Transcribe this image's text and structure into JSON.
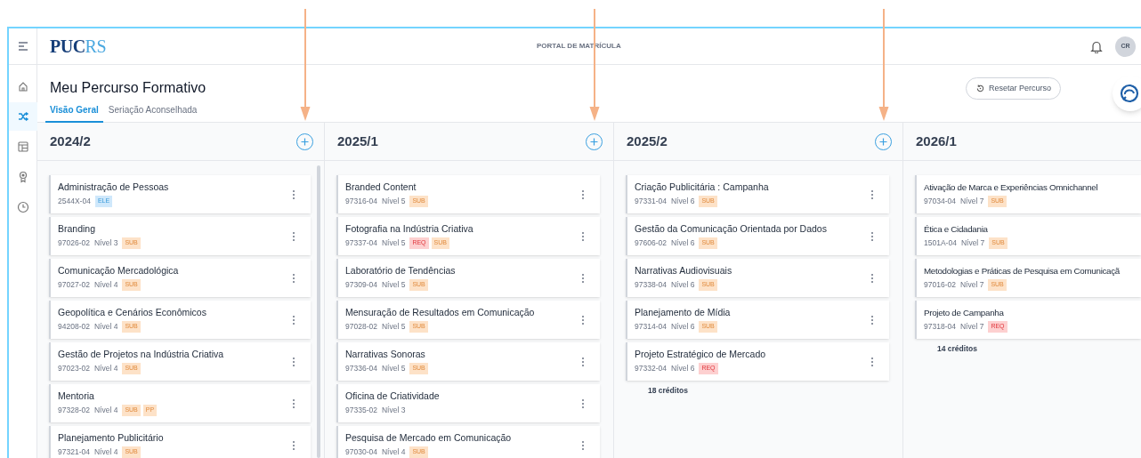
{
  "sidebar": {
    "items": [
      {
        "selected": false
      },
      {
        "selected": true
      },
      {
        "selected": false
      },
      {
        "selected": false
      },
      {
        "selected": false
      }
    ]
  },
  "header": {
    "logo": [
      "PUC",
      "RS"
    ],
    "portal": "PORTAL DE MATRÍCULA",
    "avatar": "CR"
  },
  "page": {
    "title": "Meu Percurso Formativo",
    "reset_button": "Resetar Percurso"
  },
  "tabs": [
    {
      "label": "Visão Geral",
      "selected": true
    },
    {
      "label": "Seriação Aconselhada",
      "selected": false
    }
  ],
  "columns": [
    {
      "term": "2024/2",
      "add_button": true,
      "arrow_marked": true,
      "scrollbar": true,
      "courses": [
        {
          "name": "Administração de Pessoas",
          "code": "2544X-04",
          "tags": [
            {
              "label": "ELE",
              "kind": "ele"
            }
          ]
        },
        {
          "name": "Branding",
          "code": "97026-02",
          "level": "Nível 3",
          "tags": [
            {
              "label": "SUB",
              "kind": "sub"
            }
          ]
        },
        {
          "name": "Comunicação Mercadológica",
          "code": "97027-02",
          "level": "Nível 4",
          "tags": [
            {
              "label": "SUB",
              "kind": "sub"
            }
          ]
        },
        {
          "name": "Geopolítica e Cenários Econômicos",
          "code": "94208-02",
          "level": "Nível 4",
          "tags": [
            {
              "label": "SUB",
              "kind": "sub"
            }
          ]
        },
        {
          "name": "Gestão de Projetos na Indústria Criativa",
          "code": "97023-02",
          "level": "Nível 4",
          "tags": [
            {
              "label": "SUB",
              "kind": "sub"
            }
          ]
        },
        {
          "name": "Mentoria",
          "code": "97328-02",
          "level": "Nível 4",
          "tags": [
            {
              "label": "SUB",
              "kind": "sub"
            },
            {
              "label": "PP",
              "kind": "sub"
            }
          ]
        },
        {
          "name": "Planejamento Publicitário",
          "code": "97321-04",
          "level": "Nível 4",
          "tags": [
            {
              "label": "SUB",
              "kind": "sub"
            }
          ]
        }
      ]
    },
    {
      "term": "2025/1",
      "add_button": true,
      "arrow_marked": true,
      "courses": [
        {
          "name": "Branded Content",
          "code": "97316-04",
          "level": "Nível 5",
          "tags": [
            {
              "label": "SUB",
              "kind": "sub"
            }
          ]
        },
        {
          "name": "Fotografia na Indústria Criativa",
          "code": "97337-04",
          "level": "Nível 5",
          "tags": [
            {
              "label": "REQ",
              "kind": "req"
            },
            {
              "label": "SUB",
              "kind": "sub"
            }
          ]
        },
        {
          "name": "Laboratório de Tendências",
          "code": "97309-04",
          "level": "Nível 5",
          "tags": [
            {
              "label": "SUB",
              "kind": "sub"
            }
          ]
        },
        {
          "name": "Mensuração de Resultados em Comunicação",
          "code": "97028-02",
          "level": "Nível 5",
          "tags": [
            {
              "label": "SUB",
              "kind": "sub"
            }
          ]
        },
        {
          "name": "Narrativas Sonoras",
          "code": "97336-04",
          "level": "Nível 5",
          "tags": [
            {
              "label": "SUB",
              "kind": "sub"
            }
          ]
        },
        {
          "name": "Oficina de Criatividade",
          "code": "97335-02",
          "level": "Nível 3"
        },
        {
          "name": "Pesquisa de Mercado em Comunicação",
          "code": "97030-04",
          "level": "Nível 4",
          "tags": [
            {
              "label": "SUB",
              "kind": "sub"
            }
          ]
        }
      ]
    },
    {
      "term": "2025/2",
      "add_button": true,
      "arrow_marked": true,
      "credits": "18 créditos",
      "courses": [
        {
          "name": "Criação Publicitária : Campanha",
          "code": "97331-04",
          "level": "Nível 6",
          "tags": [
            {
              "label": "SUB",
              "kind": "sub"
            }
          ]
        },
        {
          "name": "Gestão da Comunicação Orientada por Dados",
          "code": "97606-02",
          "level": "Nível 6",
          "tags": [
            {
              "label": "SUB",
              "kind": "sub"
            }
          ]
        },
        {
          "name": "Narrativas Audiovisuais",
          "code": "97338-04",
          "level": "Nível 6",
          "tags": [
            {
              "label": "SUB",
              "kind": "sub"
            }
          ]
        },
        {
          "name": "Planejamento de Mídia",
          "code": "97314-04",
          "level": "Nível 6",
          "tags": [
            {
              "label": "SUB",
              "kind": "sub"
            }
          ]
        },
        {
          "name": "Projeto Estratégico de Mercado",
          "code": "97332-04",
          "level": "Nível 6",
          "tags": [
            {
              "label": "REQ",
              "kind": "req"
            }
          ]
        }
      ]
    },
    {
      "term": "2026/1",
      "credits": "14 créditos",
      "courses": [
        {
          "name": "Ativação de Marca e Experiências Omnichannel",
          "code": "97034-04",
          "level": "Nível 7",
          "tags": [
            {
              "label": "SUB",
              "kind": "sub"
            }
          ]
        },
        {
          "name": "Ética e Cidadania",
          "code": "1501A-04",
          "level": "Nível 7",
          "tags": [
            {
              "label": "SUB",
              "kind": "sub"
            }
          ]
        },
        {
          "name": "Metodologias e Práticas de Pesquisa em Comunicaçã",
          "code": "97016-02",
          "level": "Nível 7",
          "tags": [
            {
              "label": "SUB",
              "kind": "sub"
            }
          ]
        },
        {
          "name": "Projeto de Campanha",
          "code": "97318-04",
          "level": "Nível 7",
          "tags": [
            {
              "label": "REQ",
              "kind": "req"
            }
          ]
        }
      ]
    }
  ]
}
